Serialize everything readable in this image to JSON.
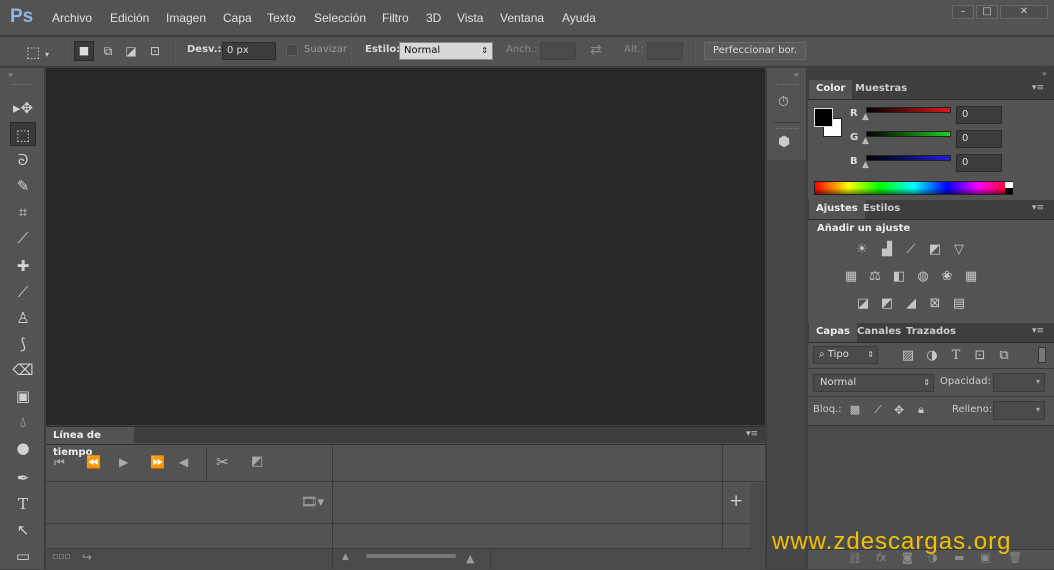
{
  "app": {
    "logo": "Ps"
  },
  "menu": [
    "Archivo",
    "Edición",
    "Imagen",
    "Capa",
    "Texto",
    "Selección",
    "Filtro",
    "3D",
    "Vista",
    "Ventana",
    "Ayuda"
  ],
  "window_controls": {
    "minimize": "–",
    "maximize": "□",
    "close": "✕"
  },
  "options": {
    "desv_label": "Desv.:",
    "desv_value": "0 px",
    "suavizar_label": "Suavizar",
    "estilo_label": "Estilo:",
    "estilo_value": "Normal",
    "anch_label": "Anch.:",
    "alt_label": "Alt.:",
    "refine_button": "Perfeccionar bor."
  },
  "color_panel": {
    "tabs": [
      "Color",
      "Muestras"
    ],
    "channels": [
      {
        "name": "R",
        "value": "0",
        "color": "#c81e1e"
      },
      {
        "name": "G",
        "value": "0",
        "color": "#20b020"
      },
      {
        "name": "B",
        "value": "0",
        "color": "#2020c8"
      }
    ]
  },
  "adjust_panel": {
    "tabs": [
      "Ajustes",
      "Estilos"
    ],
    "heading": "Añadir un ajuste"
  },
  "layers_panel": {
    "tabs": [
      "Capas",
      "Canales",
      "Trazados"
    ],
    "filter": "Tipo",
    "blend": "Normal",
    "opacity_label": "Opacidad:",
    "lock_label": "Bloq.:",
    "fill_label": "Relleno:"
  },
  "timeline": {
    "title": "Línea de tiempo"
  },
  "watermark": "www.zdescargas.org",
  "colors": {
    "accent": "#f0c000",
    "canvas": "#282828",
    "chrome": "#535353"
  }
}
